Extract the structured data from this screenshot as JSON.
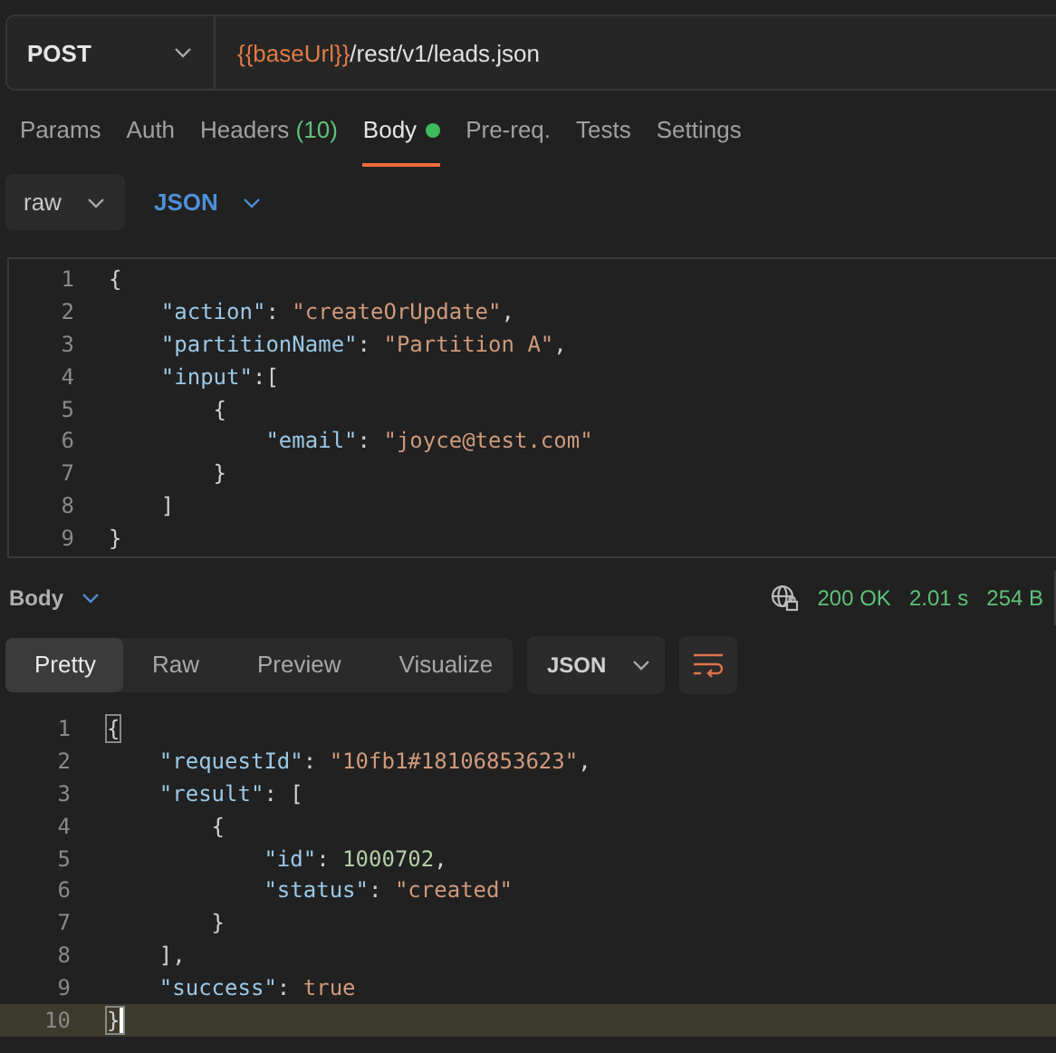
{
  "request": {
    "method": "POST",
    "url": [
      {
        "kind": "variable",
        "text": "{{baseUrl}}"
      },
      {
        "kind": "path",
        "text": "/rest/v1/leads.json"
      }
    ]
  },
  "tabs": [
    {
      "label": "Params",
      "selected": false
    },
    {
      "label": "Auth",
      "selected": false
    },
    {
      "label": "Headers",
      "count": "(10)",
      "selected": false
    },
    {
      "label": "Body",
      "selected": true,
      "dot": true
    },
    {
      "label": "Pre-req.",
      "selected": false
    },
    {
      "label": "Tests",
      "selected": false
    },
    {
      "label": "Settings",
      "selected": false
    }
  ],
  "body_mode": {
    "type": "raw",
    "language": "JSON"
  },
  "request_body": [
    {
      "number": "1",
      "tokens": [
        {
          "kind": "punct",
          "text": "{"
        }
      ]
    },
    {
      "number": "2",
      "tokens": [
        {
          "kind": "key",
          "text": "    \"action\""
        },
        {
          "kind": "punct",
          "text": ": "
        },
        {
          "kind": "string",
          "text": "\"createOrUpdate\""
        },
        {
          "kind": "punct",
          "text": ","
        }
      ]
    },
    {
      "number": "3",
      "tokens": [
        {
          "kind": "key",
          "text": "    \"partitionName\""
        },
        {
          "kind": "punct",
          "text": ": "
        },
        {
          "kind": "string",
          "text": "\"Partition A\""
        },
        {
          "kind": "punct",
          "text": ","
        }
      ]
    },
    {
      "number": "4",
      "tokens": [
        {
          "kind": "key",
          "text": "    \"input\""
        },
        {
          "kind": "punct",
          "text": ":["
        }
      ]
    },
    {
      "number": "5",
      "tokens": [
        {
          "kind": "punct",
          "text": "        {"
        }
      ]
    },
    {
      "number": "6",
      "tokens": [
        {
          "kind": "key",
          "text": "            \"email\""
        },
        {
          "kind": "punct",
          "text": ": "
        },
        {
          "kind": "string",
          "text": "\"joyce@test.com\""
        }
      ]
    },
    {
      "number": "7",
      "tokens": [
        {
          "kind": "punct",
          "text": "        }"
        }
      ]
    },
    {
      "number": "8",
      "tokens": [
        {
          "kind": "punct",
          "text": "    ]"
        }
      ]
    },
    {
      "number": "9",
      "tokens": [
        {
          "kind": "punct",
          "text": "}"
        }
      ]
    }
  ],
  "response": {
    "label": "Body",
    "status": "200 OK",
    "time": "2.01 s",
    "size": "254 B",
    "views": [
      {
        "label": "Pretty",
        "selected": true
      },
      {
        "label": "Raw",
        "selected": false
      },
      {
        "label": "Preview",
        "selected": false
      },
      {
        "label": "Visualize",
        "selected": false
      }
    ],
    "format": "JSON",
    "lines": [
      {
        "number": "1",
        "current": false,
        "tokens": [
          {
            "kind": "bracket",
            "text": "{"
          }
        ]
      },
      {
        "number": "2",
        "current": false,
        "tokens": [
          {
            "kind": "key",
            "text": "    \"requestId\""
          },
          {
            "kind": "punct",
            "text": ": "
          },
          {
            "kind": "string",
            "text": "\"10fb1#18106853623\""
          },
          {
            "kind": "punct",
            "text": ","
          }
        ]
      },
      {
        "number": "3",
        "current": false,
        "tokens": [
          {
            "kind": "key",
            "text": "    \"result\""
          },
          {
            "kind": "punct",
            "text": ": ["
          }
        ]
      },
      {
        "number": "4",
        "current": false,
        "tokens": [
          {
            "kind": "punct",
            "text": "        {"
          }
        ]
      },
      {
        "number": "5",
        "current": false,
        "tokens": [
          {
            "kind": "key",
            "text": "            \"id\""
          },
          {
            "kind": "punct",
            "text": ": "
          },
          {
            "kind": "number",
            "text": "1000702"
          },
          {
            "kind": "punct",
            "text": ","
          }
        ]
      },
      {
        "number": "6",
        "current": false,
        "tokens": [
          {
            "kind": "key",
            "text": "            \"status\""
          },
          {
            "kind": "punct",
            "text": ": "
          },
          {
            "kind": "string",
            "text": "\"created\""
          }
        ]
      },
      {
        "number": "7",
        "current": false,
        "tokens": [
          {
            "kind": "punct",
            "text": "        }"
          }
        ]
      },
      {
        "number": "8",
        "current": false,
        "tokens": [
          {
            "kind": "punct",
            "text": "    ],"
          }
        ]
      },
      {
        "number": "9",
        "current": false,
        "tokens": [
          {
            "kind": "key",
            "text": "    \"success\""
          },
          {
            "kind": "punct",
            "text": ": "
          },
          {
            "kind": "bool",
            "text": "true"
          }
        ]
      },
      {
        "number": "10",
        "current": true,
        "tokens": [
          {
            "kind": "bracket",
            "text": "}"
          }
        ]
      }
    ]
  }
}
